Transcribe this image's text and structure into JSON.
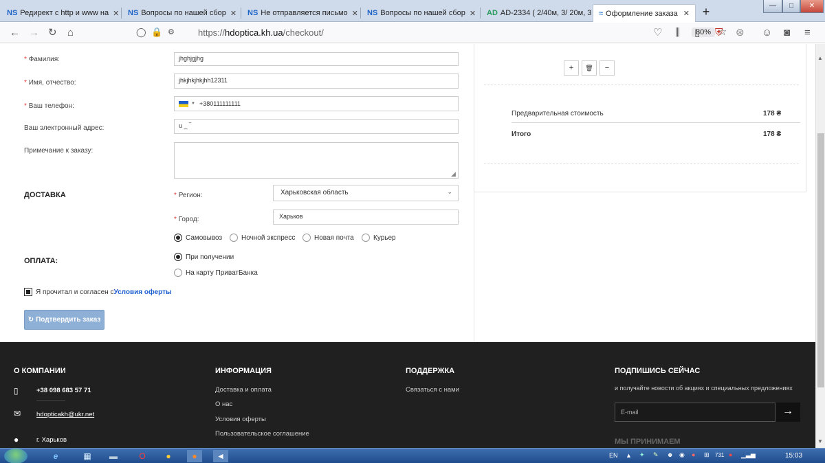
{
  "browser": {
    "tabs": [
      {
        "favicon": "NS",
        "title": "Редирект с http и www на",
        "active": false
      },
      {
        "favicon": "NS",
        "title": "Вопросы по нашей сбор",
        "active": false
      },
      {
        "favicon": "NS",
        "title": "Не отправляется письмо",
        "active": false
      },
      {
        "favicon": "NS",
        "title": "Вопросы по нашей сбор",
        "active": false
      },
      {
        "favicon": "AD",
        "title": "AD-2334 ( 2/40м, 3/ 20м, 3",
        "active": false
      },
      {
        "favicon": "≈",
        "title": "Оформление заказа",
        "active": true
      }
    ],
    "url_prefix": "https://",
    "url_host": "hdoptica.kh.ua",
    "url_path": "/checkout/",
    "zoom": "80%",
    "new_tab": "+",
    "window_buttons": {
      "minimize": "—",
      "maximize": "□",
      "close": "✕"
    }
  },
  "form": {
    "surname_label": "Фамилия:",
    "surname_value": "jhghjgjhg",
    "name_label": "Имя, отчество:",
    "name_value": "jhkjhkjhkjhh12311",
    "phone_label": "Ваш телефон:",
    "phone_value": "+380111111111",
    "email_label": "Ваш электронный адрес:",
    "email_value": "u  _  ‾",
    "note_label": "Примечание к заказу:",
    "note_value": "",
    "required_mark": "*"
  },
  "delivery": {
    "heading": "ДОСТАВКА",
    "region_label": "Регион:",
    "region_value": "Харьковская область",
    "city_label": "Город:",
    "city_value": "Харьков",
    "options": [
      {
        "label": "Самовывоз",
        "selected": true
      },
      {
        "label": "Ночной экспресс",
        "selected": false
      },
      {
        "label": "Новая почта",
        "selected": false
      },
      {
        "label": "Курьер",
        "selected": false
      }
    ]
  },
  "payment": {
    "heading": "ОПЛАТА:",
    "options": [
      {
        "label": "При получении",
        "selected": true
      },
      {
        "label": "На карту ПриватБанка",
        "selected": false
      }
    ]
  },
  "agreement": {
    "text": "Я прочитал и согласен с",
    "link": "Условия оферты",
    "checked": true
  },
  "submit_label": "Подтвердить заказ",
  "summary": {
    "qty_plus": "+",
    "qty_delete": "🗑",
    "qty_minus": "−",
    "subtotal_label": "Предварительная стоимость",
    "subtotal_value": "178 ₴",
    "total_label": "Итого",
    "total_value": "178 ₴"
  },
  "footer": {
    "company": {
      "heading": "О КОМПАНИИ",
      "phone": "+38 098 683 57 71",
      "email": "hdopticakh@ukr.net",
      "city": "г. Харьков"
    },
    "info": {
      "heading": "ИНФОРМАЦИЯ",
      "links": [
        "Доставка и оплата",
        "О нас",
        "Условия оферты",
        "Пользовательское соглашение"
      ]
    },
    "support": {
      "heading": "ПОДДЕРЖКА",
      "links": [
        "Связаться с нами"
      ]
    },
    "subscribe": {
      "heading": "ПОДПИШИСЬ СЕЙЧАС",
      "text": "и получайте новости об акциях и специальных предложениях",
      "placeholder": "E-mail",
      "button": "→",
      "accept_heading": "МЫ ПРИНИМАЕМ"
    }
  },
  "taskbar": {
    "lang": "EN",
    "tray_count": "731",
    "time": "15:03"
  }
}
